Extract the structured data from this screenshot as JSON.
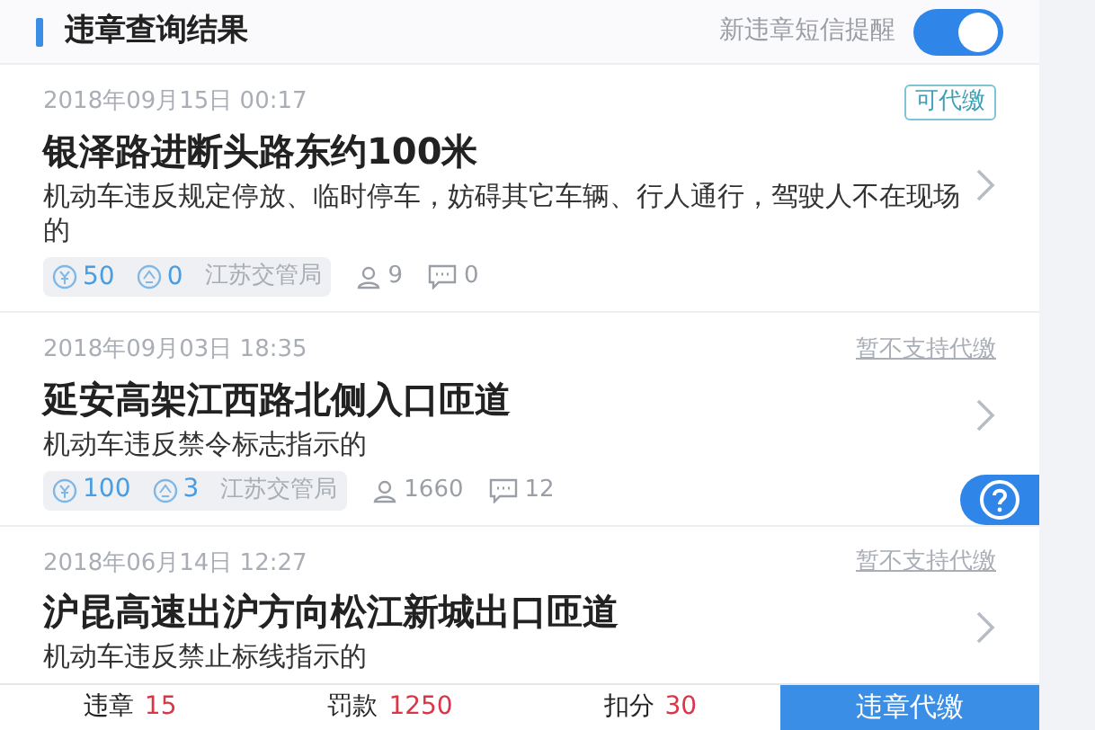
{
  "header": {
    "title": "违章查询结果",
    "sms_label": "新违章短信提醒",
    "sms_toggle": {
      "on": true
    }
  },
  "records": [
    {
      "datetime": "2018年09月15日 00:17",
      "status": "可代缴",
      "payable": true,
      "location": "银泽路进断头路东约100米",
      "description": "机动车违反规定停放、临时停车，妨碍其它车辆、行人通行，驾驶人不在现场的",
      "fine": "50",
      "points": "0",
      "authority": "江苏交管局",
      "users": "9",
      "comments": "0"
    },
    {
      "datetime": "2018年09月03日 18:35",
      "status": "暂不支持代缴",
      "payable": false,
      "location": "延安高架江西路北侧入口匝道",
      "description": "机动车违反禁令标志指示的",
      "fine": "100",
      "points": "3",
      "authority": "江苏交管局",
      "users": "1660",
      "comments": "12"
    },
    {
      "datetime": "2018年06月14日 12:27",
      "status": "暂不支持代缴",
      "payable": false,
      "location": "沪昆高速出沪方向松江新城出口匝道",
      "description": "机动车违反禁止标线指示的"
    }
  ],
  "summary": [
    {
      "label": "违章",
      "value": "15"
    },
    {
      "label": "罚款",
      "value": "1250"
    },
    {
      "label": "扣分",
      "value": "30"
    }
  ],
  "pay_button": "违章代缴"
}
